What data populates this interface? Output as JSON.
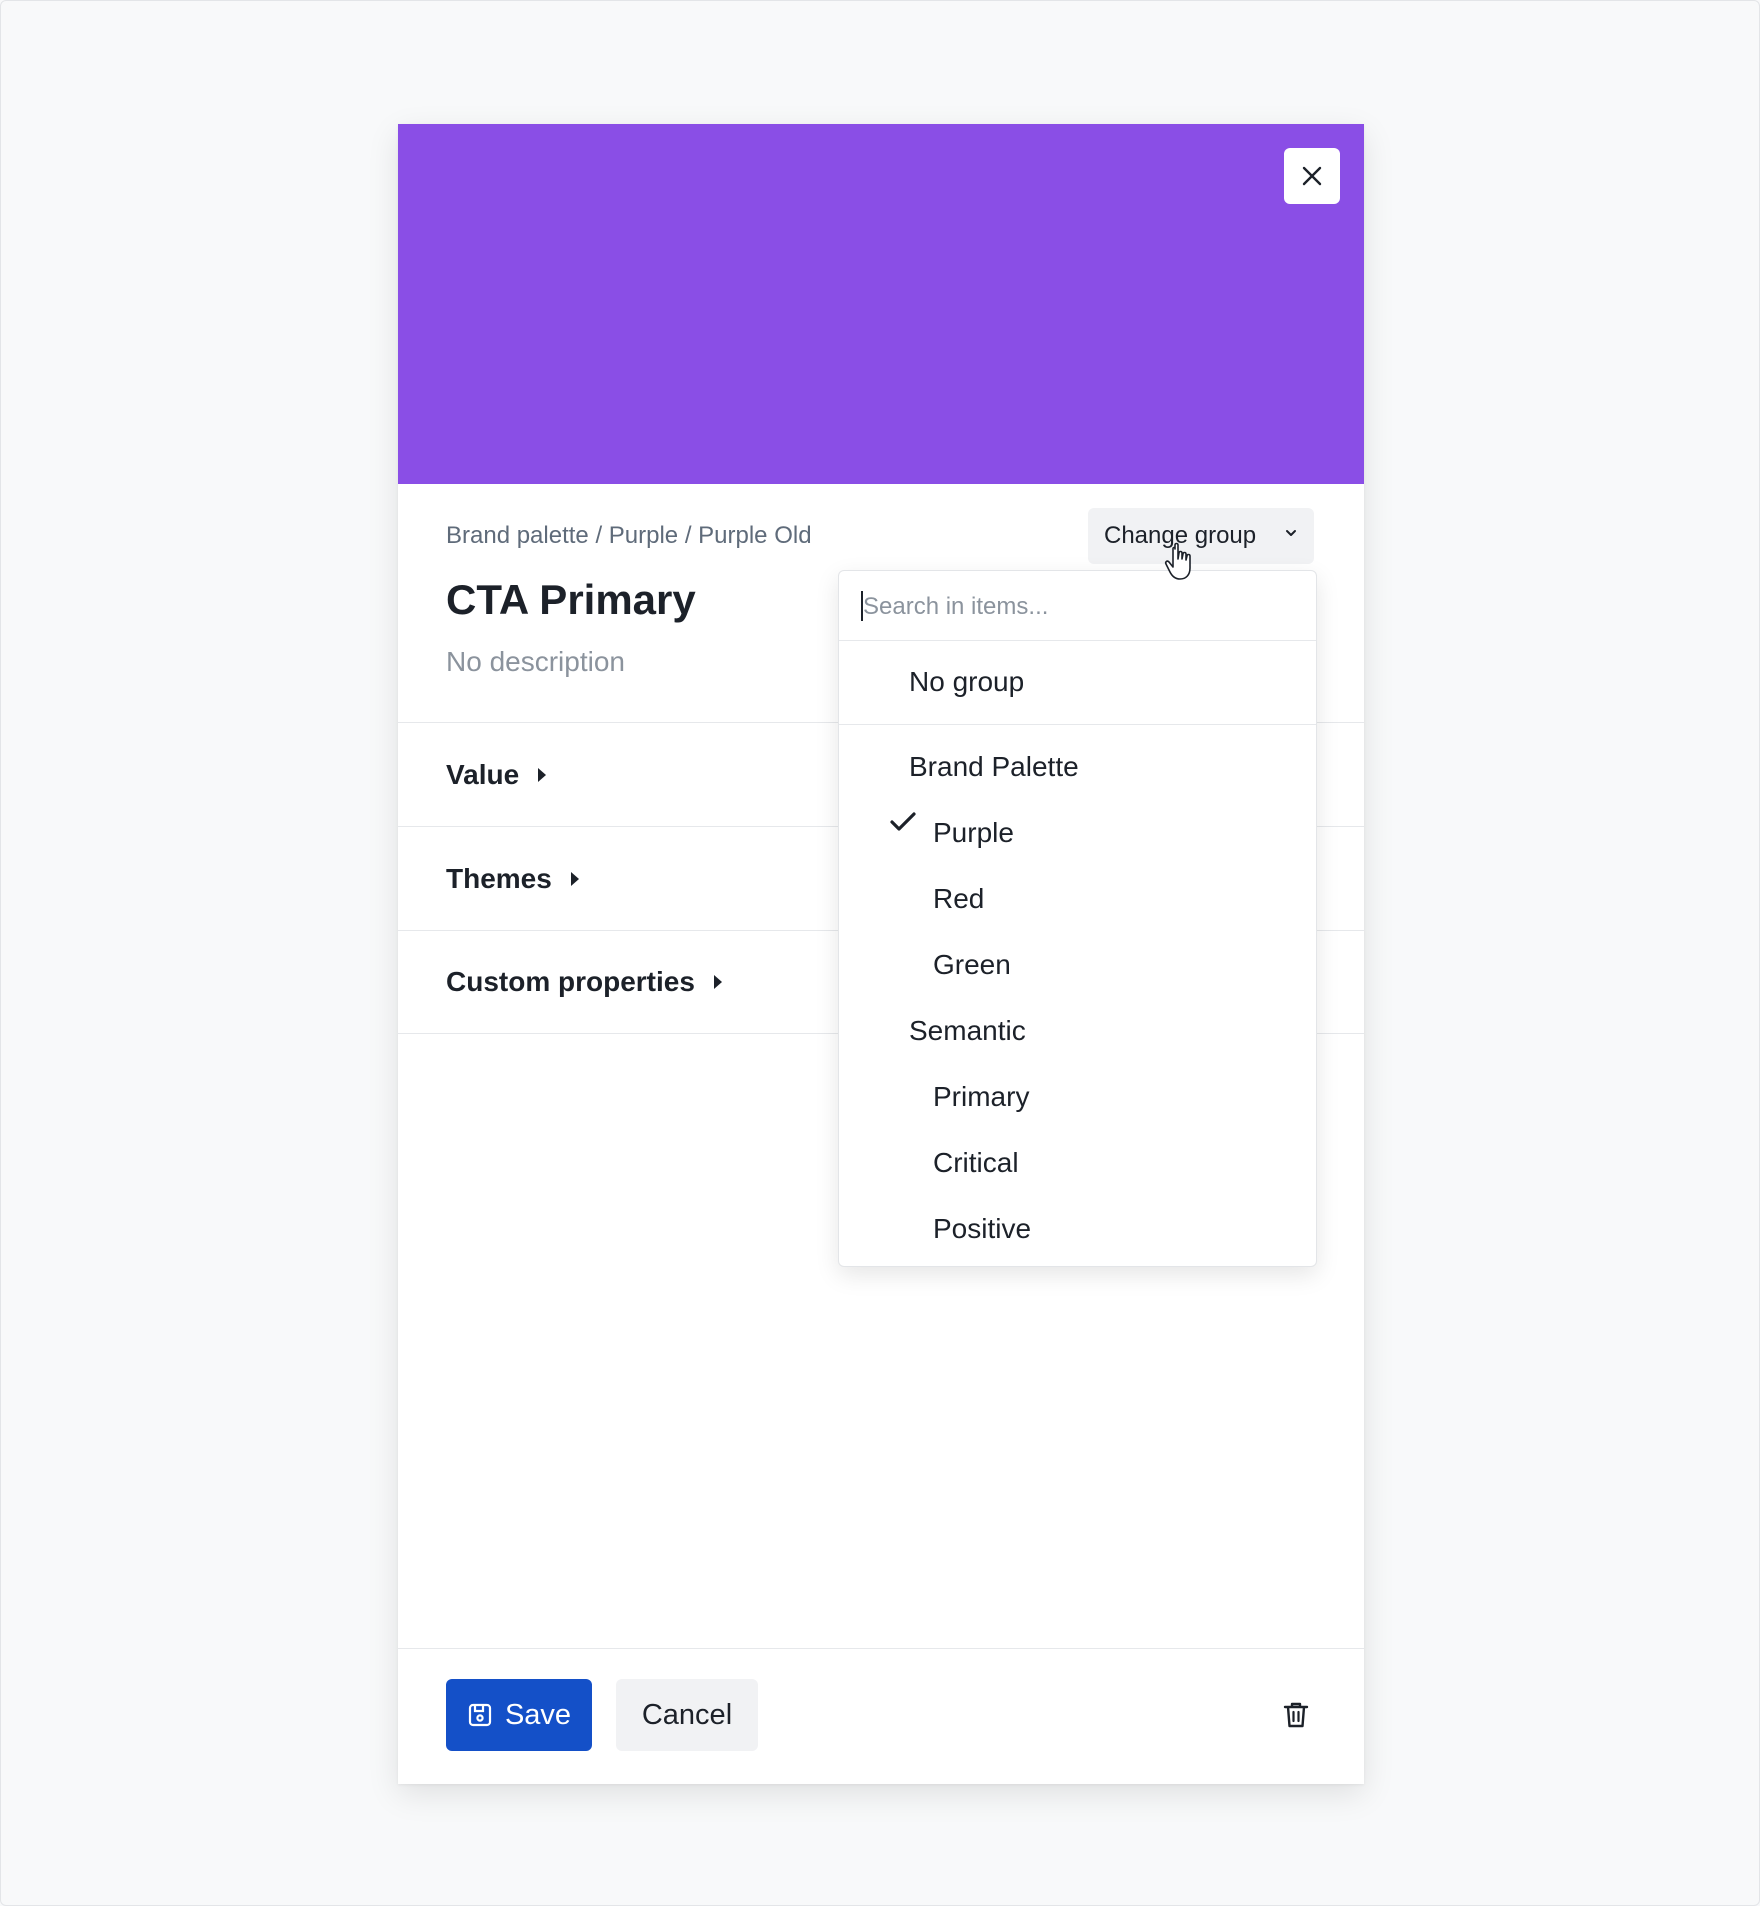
{
  "colors": {
    "swatch": "#8a4ee6",
    "save_button": "#1450c8"
  },
  "header": {
    "breadcrumb": "Brand palette / Purple / Purple Old",
    "title": "CTA Primary",
    "description": "No description",
    "change_group_label": "Change group"
  },
  "sections": [
    {
      "label": "Value"
    },
    {
      "label": "Themes"
    },
    {
      "label": "Custom properties"
    }
  ],
  "footer": {
    "save_label": "Save",
    "cancel_label": "Cancel"
  },
  "dropdown": {
    "search_placeholder": "Search in items...",
    "search_value": "",
    "no_group_label": "No group",
    "items": [
      {
        "label": "Brand Palette",
        "level": 0,
        "selected": false
      },
      {
        "label": "Purple",
        "level": 1,
        "selected": true
      },
      {
        "label": "Red",
        "level": 1,
        "selected": false
      },
      {
        "label": "Green",
        "level": 1,
        "selected": false
      },
      {
        "label": "Semantic",
        "level": 0,
        "selected": false
      },
      {
        "label": "Primary",
        "level": 1,
        "selected": false
      },
      {
        "label": "Critical",
        "level": 1,
        "selected": false
      },
      {
        "label": "Positive",
        "level": 1,
        "selected": false
      }
    ]
  },
  "icons": {
    "close": "close-icon",
    "chevron": "chevron-down-icon",
    "caret": "caret-right-icon",
    "save": "floppy-disk-icon",
    "trash": "trash-icon",
    "check": "check-icon",
    "pointer": "hand-pointer-icon"
  }
}
